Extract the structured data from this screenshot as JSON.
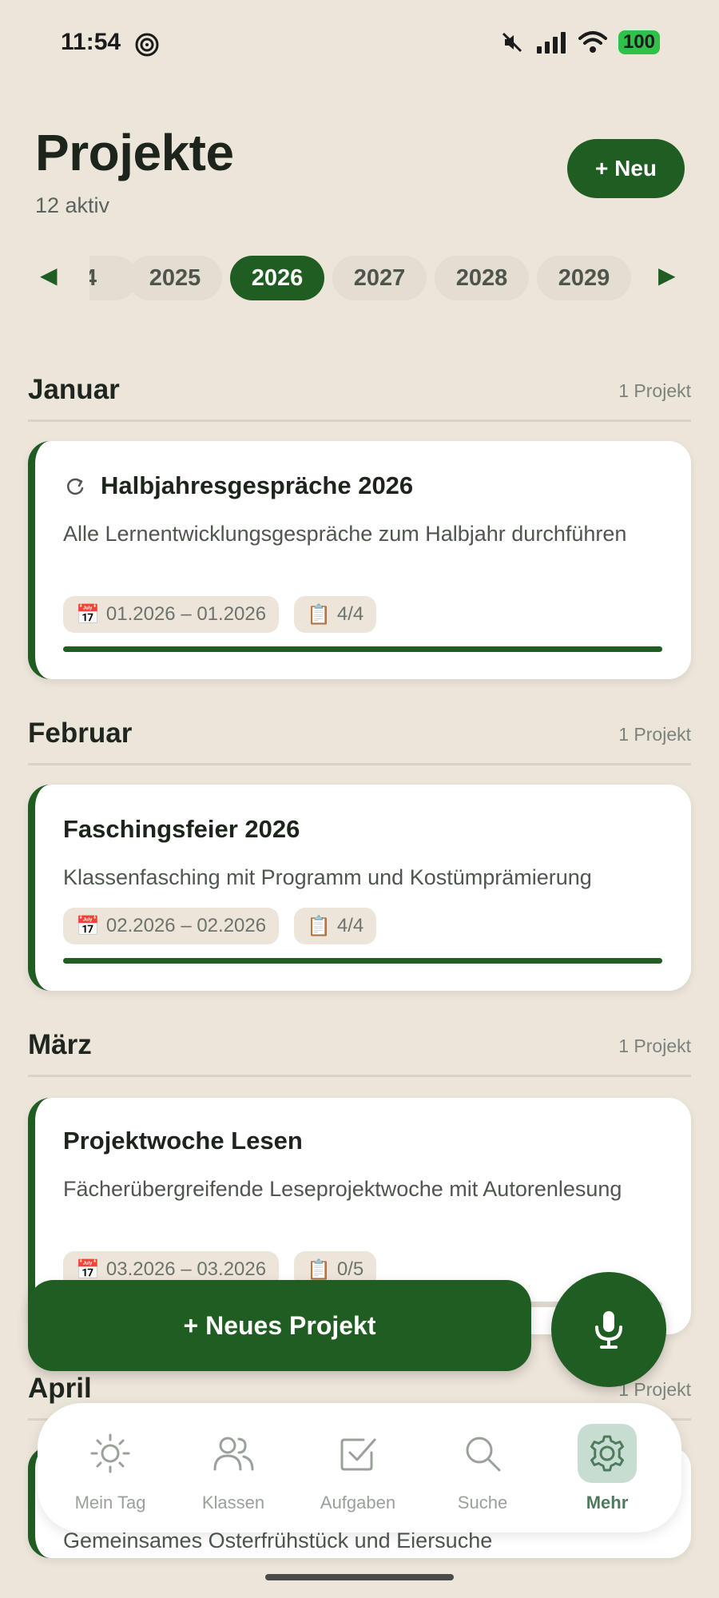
{
  "status_bar": {
    "time": "11:54",
    "battery": "100"
  },
  "header": {
    "title": "Projekte",
    "subtitle": "12 aktiv",
    "new_button": "+ Neu"
  },
  "years": {
    "prev_arrow": "◀",
    "next_arrow": "▶",
    "items": [
      {
        "label": "4",
        "active": false
      },
      {
        "label": "2025",
        "active": false
      },
      {
        "label": "2026",
        "active": true
      },
      {
        "label": "2027",
        "active": false
      },
      {
        "label": "2028",
        "active": false
      },
      {
        "label": "2029",
        "active": false
      }
    ]
  },
  "sections": [
    {
      "month": "Januar",
      "count": "1 Projekt",
      "project": {
        "title": "Halbjahresgespräche 2026",
        "recurring": true,
        "description": "Alle Lernentwicklungsgespräche zum Halbjahr durchführen",
        "date_range": "01.2026 – 01.2026",
        "tasks": "4/4",
        "progress": 1.0
      }
    },
    {
      "month": "Februar",
      "count": "1 Projekt",
      "project": {
        "title": "Faschingsfeier 2026",
        "recurring": false,
        "description": "Klassenfasching mit Programm und Kostümprämierung",
        "date_range": "02.2026 – 02.2026",
        "tasks": "4/4",
        "progress": 1.0
      }
    },
    {
      "month": "März",
      "count": "1 Projekt",
      "project": {
        "title": "Projektwoche Lesen",
        "recurring": false,
        "description": "Fächerübergreifende Leseprojektwoche mit Autorenlesung",
        "date_range": "03.2026 – 03.2026",
        "tasks": "0/5",
        "progress": 0.0
      }
    },
    {
      "month": "April",
      "count": "1 Projekt",
      "project": {
        "description": "Gemeinsames Osterfrühstück und Eiersuche"
      }
    }
  ],
  "icons": {
    "calendar": "📅",
    "clipboard": "📋"
  },
  "floating": {
    "new_project_button": "+ Neues Projekt"
  },
  "bottom_nav": [
    {
      "label": "Mein Tag",
      "icon": "sun-icon",
      "active": false
    },
    {
      "label": "Klassen",
      "icon": "users-icon",
      "active": false
    },
    {
      "label": "Aufgaben",
      "icon": "checkbox-icon",
      "active": false
    },
    {
      "label": "Suche",
      "icon": "search-icon",
      "active": false
    },
    {
      "label": "Mehr",
      "icon": "gear-icon",
      "active": true
    }
  ],
  "colors": {
    "accent": "#1f5d22",
    "background": "#ece5da",
    "nav_active_bg": "#c8ddd2"
  }
}
